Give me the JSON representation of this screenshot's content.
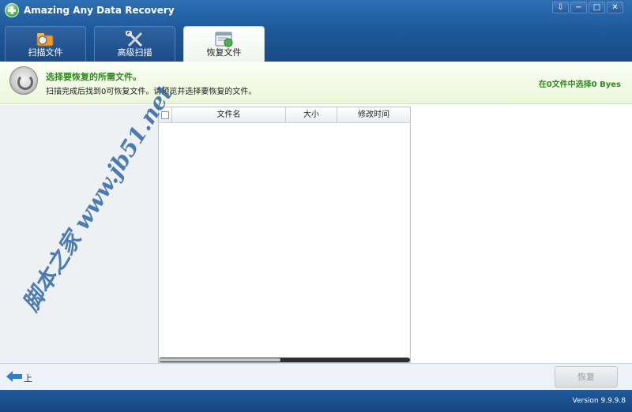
{
  "app": {
    "title": "Amazing Any Data Recovery",
    "window_controls": [
      "download",
      "minimize",
      "maximize",
      "close"
    ]
  },
  "tabs": [
    {
      "label": "扫描文件",
      "icon": "folder-scan-icon",
      "active": false
    },
    {
      "label": "高级扫描",
      "icon": "tools-icon",
      "active": false
    },
    {
      "label": "恢复文件",
      "icon": "recover-file-icon",
      "active": true
    }
  ],
  "header": {
    "title": "选择要恢复的所需文件。",
    "subtitle": "扫描完成后找到0可恢复文件。请预览并选择要恢复的文件。",
    "selected_count": "在0文件中选择0 Byes"
  },
  "table": {
    "columns": [
      "文件名",
      "大小",
      "修改时间"
    ],
    "rows": []
  },
  "footer": {
    "back_label": "上",
    "recover_label": "恢复",
    "version": "Version 9.9.9.8"
  },
  "watermark": {
    "text": "脚本之家 www.jb51.net"
  },
  "colors": {
    "brand_blue": "#1f5a9c",
    "green_text": "#2d8a1f",
    "header_bg": "#eaf6d8"
  }
}
